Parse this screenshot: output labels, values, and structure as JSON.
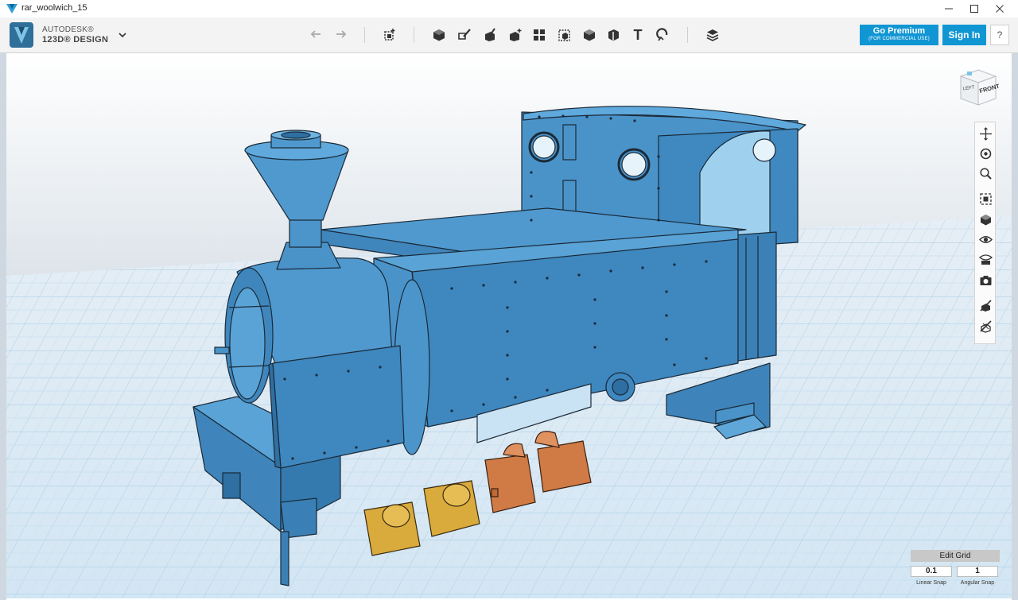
{
  "window": {
    "title": "rar_woolwich_15",
    "minimize_icon": "minimize-icon",
    "maximize_icon": "maximize-icon",
    "close_icon": "close-icon"
  },
  "app": {
    "brand_line1": "AUTODESK®",
    "brand_line2": "123D® DESIGN",
    "accent_color": "#1196d4",
    "model_color": "#4a93c9",
    "part_yellow": "#d9ab3c",
    "part_orange": "#d07b45"
  },
  "toolbar": {
    "tools": [
      {
        "name": "undo-icon"
      },
      {
        "name": "redo-icon"
      },
      {
        "name": "transform-icon"
      },
      {
        "name": "primitives-icon"
      },
      {
        "name": "sketch-icon"
      },
      {
        "name": "construct-icon"
      },
      {
        "name": "modify-icon"
      },
      {
        "name": "pattern-icon"
      },
      {
        "name": "grouping-icon"
      },
      {
        "name": "combine-icon"
      },
      {
        "name": "measure-icon"
      },
      {
        "name": "text-icon"
      },
      {
        "name": "snap-icon"
      },
      {
        "name": "materials-icon"
      }
    ],
    "text_glyph": "T",
    "premium_label": "Go Premium",
    "premium_sub": "(FOR COMMERCIAL USE)",
    "signin_label": "Sign In",
    "help_label": "?"
  },
  "viewcube": {
    "left_label": "LEFT",
    "front_label": "FRONT"
  },
  "navbar": [
    {
      "name": "pan-icon"
    },
    {
      "name": "orbit-icon"
    },
    {
      "name": "zoom-icon"
    },
    {
      "name": "fit-icon"
    },
    {
      "name": "view-cube-icon"
    },
    {
      "name": "visibility-icon"
    },
    {
      "name": "materials-view-icon"
    },
    {
      "name": "camera-icon"
    },
    {
      "name": "hide-sketch-icon"
    },
    {
      "name": "hide-mesh-icon"
    }
  ],
  "grid": {
    "title": "Edit Grid",
    "linear_value": "0.1",
    "angular_value": "1",
    "linear_label": "Linear Snap",
    "angular_label": "Angular Snap"
  }
}
